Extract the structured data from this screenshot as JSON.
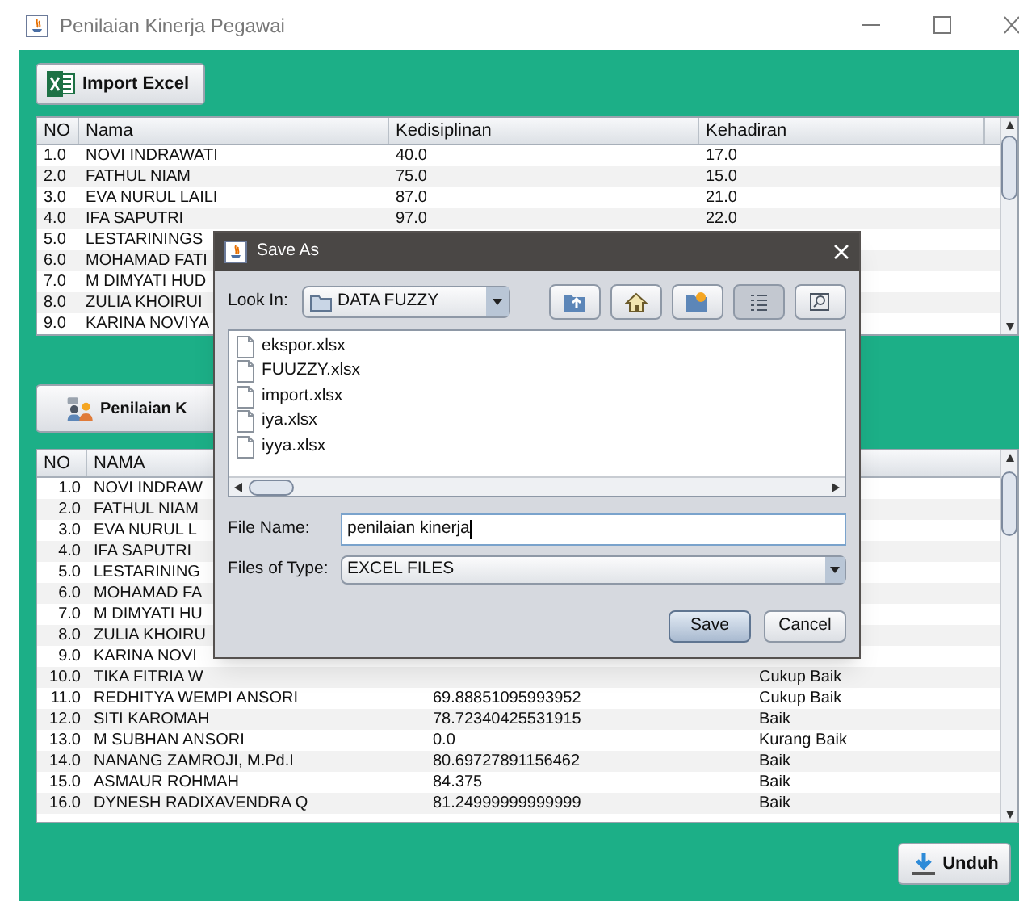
{
  "window": {
    "title": "Penilaian Kinerja Pegawai"
  },
  "import_button": {
    "label": "Import Excel"
  },
  "top_table": {
    "columns": [
      "NO",
      "Nama",
      "Kedisiplinan",
      "Kehadiran"
    ],
    "rows": [
      [
        "1.0",
        "NOVI INDRAWATI",
        "40.0",
        "17.0"
      ],
      [
        "2.0",
        "FATHUL NIAM",
        "75.0",
        "15.0"
      ],
      [
        "3.0",
        "EVA NURUL LAILI",
        "87.0",
        "21.0"
      ],
      [
        "4.0",
        "IFA SAPUTRI",
        "97.0",
        "22.0"
      ],
      [
        "5.0",
        "LESTARININGS"
      ],
      [
        "6.0",
        "MOHAMAD FATI"
      ],
      [
        "7.0",
        "M DIMYATI HUD"
      ],
      [
        "8.0",
        "ZULIA KHOIRUI"
      ],
      [
        "9.0",
        "KARINA NOVIYA"
      ]
    ]
  },
  "assess_button": {
    "label": "Penilaian K"
  },
  "bottom_table": {
    "columns": [
      "NO",
      "NAMA"
    ],
    "rows": [
      [
        "1.0",
        "NOVI INDRAW"
      ],
      [
        "2.0",
        "FATHUL NIAM"
      ],
      [
        "3.0",
        "EVA NURUL L"
      ],
      [
        "4.0",
        "IFA SAPUTRI"
      ],
      [
        "5.0",
        "LESTARINING"
      ],
      [
        "6.0",
        "MOHAMAD FA"
      ],
      [
        "7.0",
        "M DIMYATI HU"
      ],
      [
        "8.0",
        "ZULIA KHOIRU"
      ],
      [
        "9.0",
        "KARINA NOVI"
      ],
      [
        "10.0",
        "TIKA FITRIA W",
        "",
        "Cukup Baik"
      ],
      [
        "11.0",
        "REDHITYA WEMPI ANSORI",
        "69.88851095993952",
        "Cukup Baik"
      ],
      [
        "12.0",
        "SITI KAROMAH",
        "78.72340425531915",
        "Baik"
      ],
      [
        "13.0",
        "M SUBHAN ANSORI",
        "0.0",
        "Kurang Baik"
      ],
      [
        "14.0",
        "NANANG ZAMROJI, M.Pd.I",
        "80.69727891156462",
        "Baik"
      ],
      [
        "15.0",
        "ASMAUR ROHMAH",
        "84.375",
        "Baik"
      ],
      [
        "16.0",
        "DYNESH RADIXAVENDRA Q",
        "81.24999999999999",
        "Baik"
      ]
    ]
  },
  "download_button": {
    "label": "Unduh"
  },
  "dialog": {
    "title": "Save As",
    "look_in_label": "Look In:",
    "look_in_value": "DATA FUZZY",
    "view_toggles": [
      {
        "selected": true
      },
      {
        "selected": false
      }
    ],
    "files": [
      "ekspor.xlsx",
      "FUUZZY.xlsx",
      "import.xlsx",
      "iya.xlsx",
      "iyya.xlsx"
    ],
    "file_name_label": "File Name:",
    "file_name_value": "penilaian kinerja",
    "file_type_label": "Files of Type:",
    "file_type_value": "EXCEL FILES",
    "buttons": [
      "Save",
      "Cancel"
    ]
  }
}
